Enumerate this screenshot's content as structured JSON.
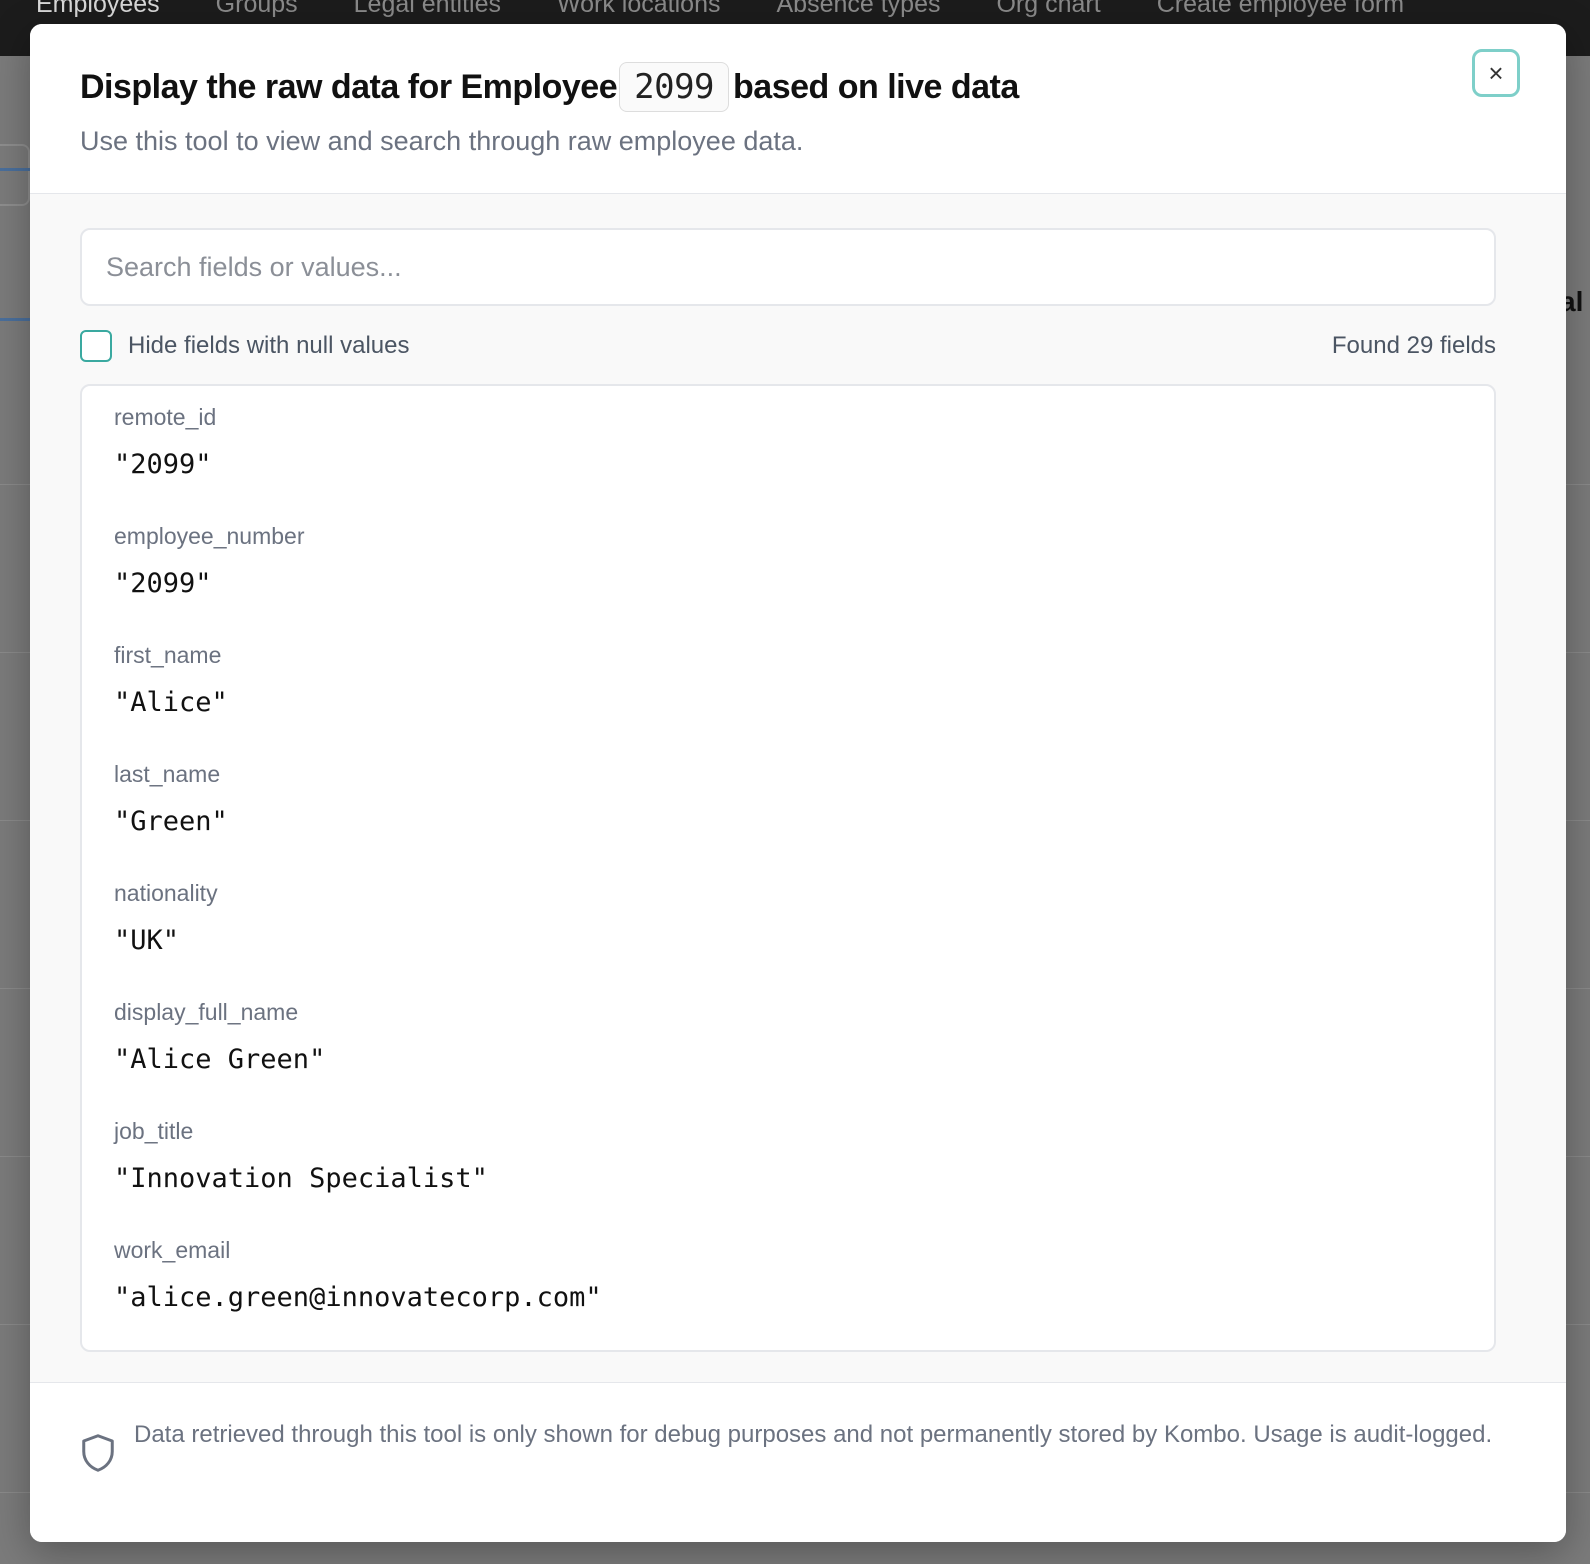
{
  "background": {
    "nav_tabs": [
      "Employees",
      "Groups",
      "Legal entities",
      "Work locations",
      "Absence types",
      "Org chart",
      "Create employee form"
    ],
    "edge_text": "al"
  },
  "modal": {
    "title_before": "Display the raw data for Employee",
    "employee_id": "2099",
    "title_after": "based on live data",
    "subtitle": "Use this tool to view and search through raw employee data.",
    "close_icon": "×"
  },
  "search": {
    "placeholder": "Search fields or values...",
    "value": ""
  },
  "filter": {
    "hide_null_label": "Hide fields with null values",
    "hide_null_checked": false,
    "found_count": "Found 29 fields"
  },
  "fields": [
    {
      "name": "remote_id",
      "value": "\"2099\""
    },
    {
      "name": "employee_number",
      "value": "\"2099\""
    },
    {
      "name": "first_name",
      "value": "\"Alice\""
    },
    {
      "name": "last_name",
      "value": "\"Green\""
    },
    {
      "name": "nationality",
      "value": "\"UK\""
    },
    {
      "name": "display_full_name",
      "value": "\"Alice Green\""
    },
    {
      "name": "job_title",
      "value": "\"Innovation Specialist\""
    },
    {
      "name": "work_email",
      "value": "\"alice.green@innovatecorp.com\""
    }
  ],
  "footer": {
    "icon": "shield-icon",
    "text": "Data retrieved through this tool is only shown for debug purposes and not permanently stored by Kombo. Usage is audit-logged."
  },
  "colors": {
    "accent_teal": "#3aa9a0",
    "close_border": "#7ecfc9"
  }
}
